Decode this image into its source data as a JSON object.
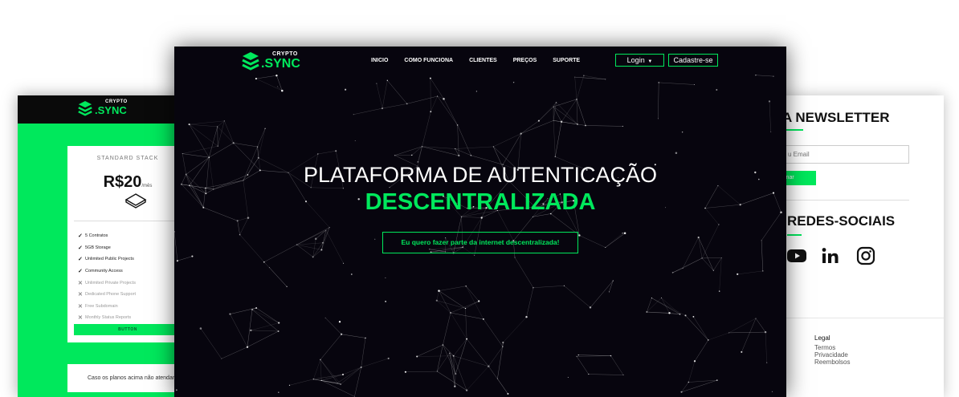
{
  "left_page": {
    "logo": {
      "small": "CRYPTO",
      "big": ".SYNC"
    },
    "plan": {
      "title": "STANDARD STACK",
      "price": "R$20",
      "period": "/mês",
      "features": [
        {
          "label": "5 Contratos",
          "included": true
        },
        {
          "label": "5GB Storage",
          "included": true
        },
        {
          "label": "Unlimited Public Projects",
          "included": true
        },
        {
          "label": "Community Access",
          "included": true
        },
        {
          "label": "Unlimited Private Projects",
          "included": false
        },
        {
          "label": "Dedicated Phone Support",
          "included": false
        },
        {
          "label": "Free Subdomain",
          "included": false
        },
        {
          "label": "Monthly Status Reports",
          "included": false
        }
      ],
      "button_label": "BUTTON"
    },
    "note": "Caso os planos acima não atendam"
  },
  "center_page": {
    "logo": {
      "small": "CRYPTO",
      "big": ".SYNC"
    },
    "nav": [
      "INICIO",
      "COMO FUNCIONA",
      "CLIENTES",
      "PREÇOS",
      "SUPORTE"
    ],
    "login_label": "Login",
    "signup_label": "Cadastre-se",
    "hero_title": "PLATAFORMA DE AUTENTICAÇÃO",
    "hero_subtitle": "DESCENTRALIZADA",
    "cta_label": "Eu quero fazer parte da internet descentralizada!"
  },
  "right_page": {
    "newsletter_title": "A NEWSLETTER",
    "email_placeholder": "u Email",
    "subscribe_label": "ssinar",
    "social_title": "REDES-SOCIAIS",
    "social_icons": [
      "youtube-icon",
      "linkedin-icon",
      "instagram-icon"
    ],
    "legal_title": "Legal",
    "legal_links": [
      "Termos",
      "Privacidade",
      "Reembolsos"
    ]
  },
  "colors": {
    "accent": "#00e85c",
    "dark_bg": "#07050e",
    "header_bg": "#0a0a0a",
    "white": "#ffffff"
  }
}
